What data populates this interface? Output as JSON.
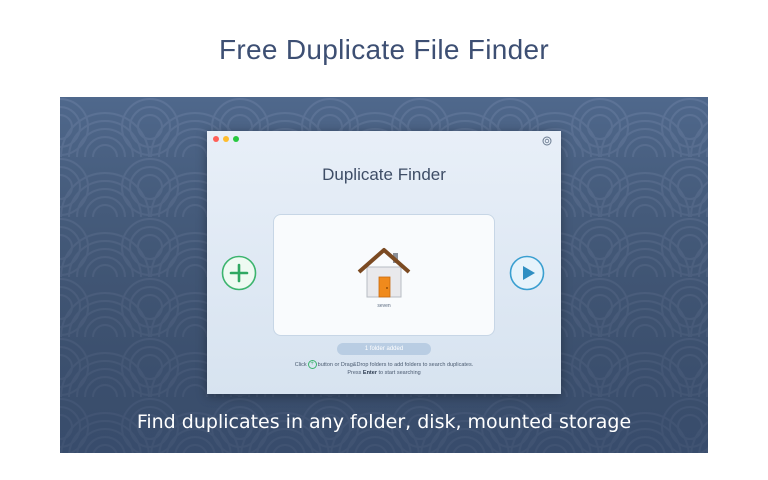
{
  "headline": "Free Duplicate File Finder",
  "caption": "Find duplicates in any folder, disk, mounted storage",
  "window": {
    "title": "Duplicate Finder",
    "traffic_lights": {
      "close": "#ff5f57",
      "minimize": "#febc2e",
      "zoom": "#28c840"
    },
    "help_icon": "lifebuoy-icon",
    "add_button_icon": "plus-circle-icon",
    "start_button_icon": "play-circle-icon",
    "folder": {
      "icon": "home-folder-icon",
      "label": "seven"
    },
    "status": "1 folder added",
    "hint_line1_before": "Click",
    "hint_line1_after": "button or Drag&Drop folders to add folders to search duplicates.",
    "hint_line2_before": "Press",
    "hint_line2_key": "Enter",
    "hint_line2_after": "to start searching"
  },
  "colors": {
    "headline": "#3d4f73",
    "banner_bg": "#4c6487",
    "add_green": "#3cb46e",
    "start_blue": "#3a9fd0",
    "door_orange": "#f08a1c"
  }
}
